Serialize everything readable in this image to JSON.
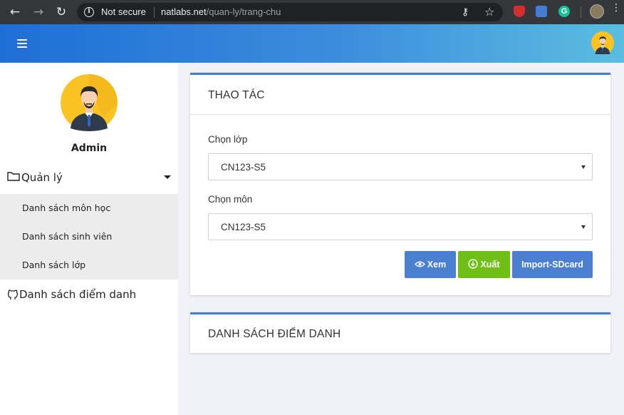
{
  "browser": {
    "security_label": "Not secure",
    "url_host": "natlabs.net",
    "url_path": "/quan-ly/trang-chu",
    "icons": [
      "back-icon",
      "forward-icon",
      "reload-icon",
      "info-icon",
      "key-icon",
      "star-icon",
      "shield-extension-icon",
      "translate-extension-icon",
      "grammarly-extension-icon",
      "profile-icon",
      "menu-icon"
    ],
    "back_glyph": "←",
    "forward_glyph": "→",
    "reload_glyph": "↻",
    "info_glyph": "i",
    "key_glyph": "⚷",
    "star_glyph": "☆",
    "grammarly_glyph": "G",
    "menu_glyph": "⋮"
  },
  "header": {
    "icons": [
      "hamburger-icon",
      "user-avatar-icon"
    ]
  },
  "sidebar": {
    "user_name": "Admin",
    "menu": {
      "group_label": "Quản lý",
      "items": [
        {
          "label": "Danh sách môn học"
        },
        {
          "label": "Danh sách sinh viên"
        },
        {
          "label": "Danh sách lớp"
        }
      ]
    },
    "attendance_label": "Danh sách điểm danh"
  },
  "actions_card": {
    "title": "THAO TÁC",
    "class_label": "Chọn lớp",
    "class_value": "CN123-S5",
    "subject_label": "Chọn môn",
    "subject_value": "CN123-S5",
    "buttons": {
      "view": "Xem",
      "export": "Xuất",
      "import": "Import-SDcard"
    }
  },
  "attendance_card": {
    "title": "DANH SÁCH ĐIỂM DANH"
  },
  "colors": {
    "header_gradient_start": "#1e6ed6",
    "header_gradient_end": "#5bbde0",
    "card_accent": "#3c7fd3",
    "primary_button": "#4b7fcf",
    "success_button": "#6fbf16",
    "submenu_bg": "#ececec",
    "page_bg": "#f0f2f7"
  }
}
